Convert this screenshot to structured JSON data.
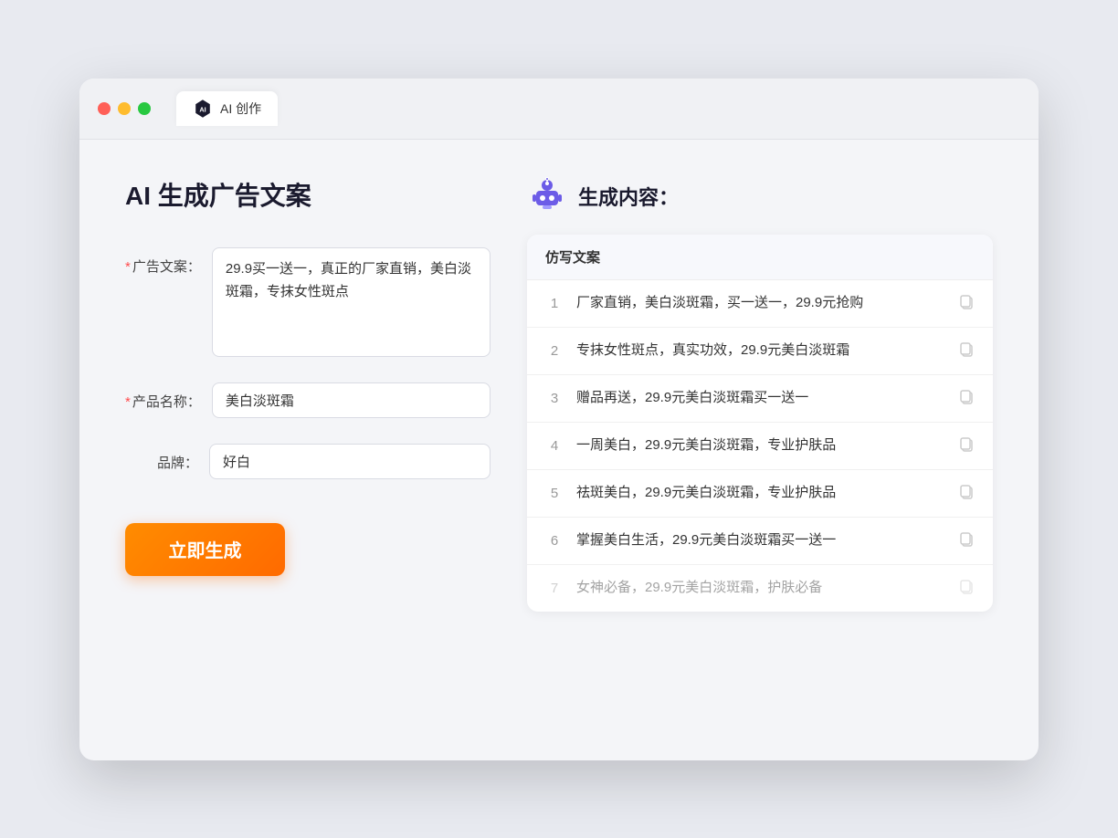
{
  "browser": {
    "tab_label": "AI 创作"
  },
  "page": {
    "title": "AI 生成广告文案",
    "generate_button": "立即生成"
  },
  "form": {
    "ad_copy_label": "广告文案：",
    "ad_copy_required": "*",
    "ad_copy_value": "29.9买一送一，真正的厂家直销，美白淡斑霜，专抹女性斑点",
    "product_name_label": "产品名称：",
    "product_name_required": "*",
    "product_name_value": "美白淡斑霜",
    "brand_label": "品牌：",
    "brand_value": "好白"
  },
  "results": {
    "header_icon": "robot",
    "header_title": "生成内容：",
    "table_column": "仿写文案",
    "items": [
      {
        "id": 1,
        "text": "厂家直销，美白淡斑霜，买一送一，29.9元抢购",
        "dimmed": false
      },
      {
        "id": 2,
        "text": "专抹女性斑点，真实功效，29.9元美白淡斑霜",
        "dimmed": false
      },
      {
        "id": 3,
        "text": "赠品再送，29.9元美白淡斑霜买一送一",
        "dimmed": false
      },
      {
        "id": 4,
        "text": "一周美白，29.9元美白淡斑霜，专业护肤品",
        "dimmed": false
      },
      {
        "id": 5,
        "text": "祛斑美白，29.9元美白淡斑霜，专业护肤品",
        "dimmed": false
      },
      {
        "id": 6,
        "text": "掌握美白生活，29.9元美白淡斑霜买一送一",
        "dimmed": false
      },
      {
        "id": 7,
        "text": "女神必备，29.9元美白淡斑霜，护肤必备",
        "dimmed": true
      }
    ]
  }
}
